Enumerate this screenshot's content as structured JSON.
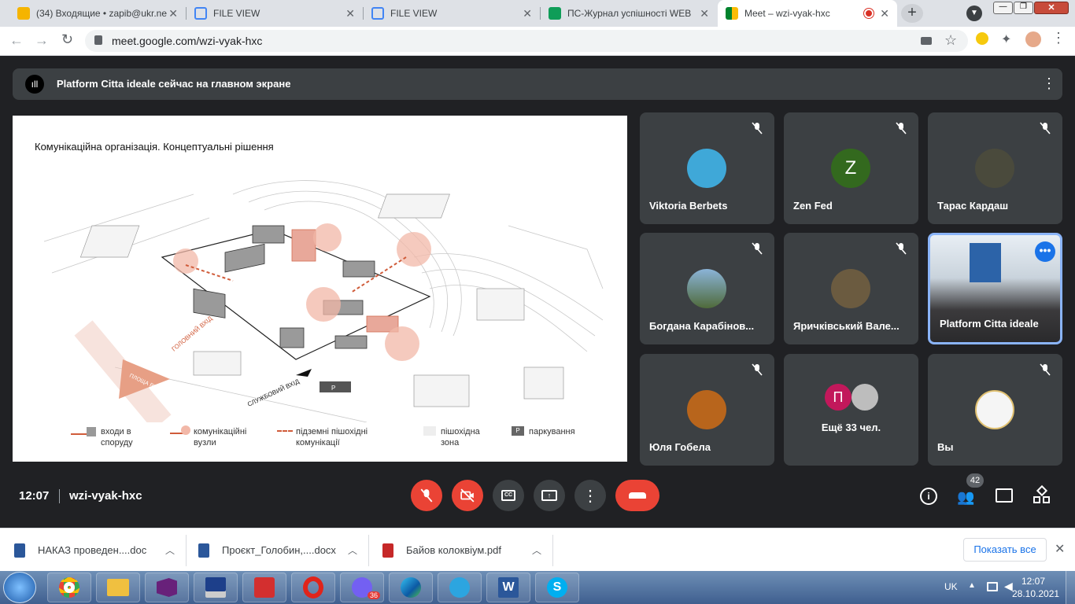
{
  "tabs": [
    {
      "title": "(34) Входящие • zapib@ukr.ne"
    },
    {
      "title": "FILE VIEW"
    },
    {
      "title": "FILE VIEW"
    },
    {
      "title": "ПС-Журнал успішності WEB"
    },
    {
      "title": "Meet – wzi-vyak-hxc"
    }
  ],
  "url": "meet.google.com/wzi-vyak-hxc",
  "banner_text": "Platform Citta ideale сейчас на главном экране",
  "slide": {
    "title": "Комунікаційна організація. Концептуальні рішення",
    "map_labels": {
      "main_entrance": "ГОЛОВНИЙ ВХІД",
      "square": "ПЛОЩА РИНОК",
      "service_entrance": "СЛУЖБОВИЙ ВХІД",
      "parking": "P"
    },
    "legend": [
      {
        "text": "входи в споруду"
      },
      {
        "text": "комунікаційні вузли"
      },
      {
        "text": "підземні пішохідні комунікації"
      },
      {
        "text": "пішохідна зона"
      },
      {
        "text": "паркування",
        "symbol": "P"
      }
    ]
  },
  "participants": [
    {
      "name": "Viktoria Berbets",
      "initial": ""
    },
    {
      "name": "Zen Fed",
      "initial": "Z"
    },
    {
      "name": "Тарас Кардаш",
      "initial": ""
    },
    {
      "name": "Богдана Карабінов...",
      "initial": ""
    },
    {
      "name": "Яричківський Вале...",
      "initial": ""
    },
    {
      "name": "Platform Citta ideale",
      "initial": ""
    },
    {
      "name": "Юля Гобела",
      "initial": ""
    },
    {
      "name": "Ещё 33 чел.",
      "initial": "П"
    },
    {
      "name": "Вы",
      "initial": ""
    }
  ],
  "bottom_bar": {
    "time": "12:07",
    "meeting_code": "wzi-vyak-hxc",
    "people_count": "42"
  },
  "downloads": [
    {
      "name": "НАКАЗ проведен....doc"
    },
    {
      "name": "Проєкт_Голобин,....docx"
    },
    {
      "name": "Байов колоквіум.pdf"
    }
  ],
  "show_all": "Показать все",
  "taskbar": {
    "lang": "UK",
    "clock": "12:07",
    "date": "28.10.2021",
    "viber_badge": "36"
  }
}
